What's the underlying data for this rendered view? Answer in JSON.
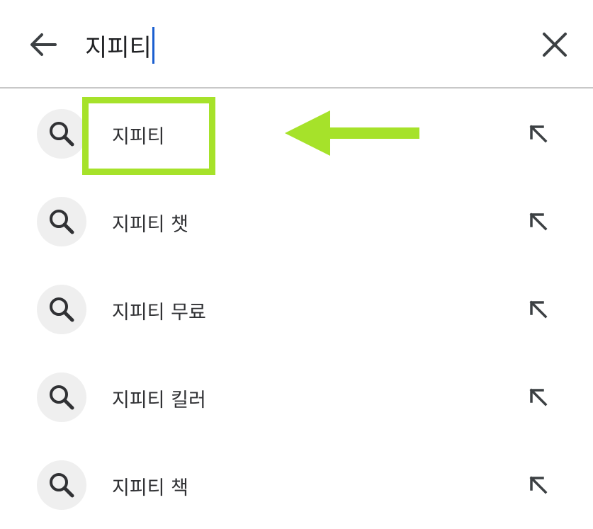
{
  "search_bar": {
    "query": "지피티",
    "back_icon": "arrow-left-icon",
    "clear_icon": "close-icon"
  },
  "suggestions": [
    {
      "label": "지피티",
      "icon": "search-icon",
      "action_icon": "arrow-up-left-icon"
    },
    {
      "label": "지피티 챗",
      "icon": "search-icon",
      "action_icon": "arrow-up-left-icon"
    },
    {
      "label": "지피티 무료",
      "icon": "search-icon",
      "action_icon": "arrow-up-left-icon"
    },
    {
      "label": "지피티 킬러",
      "icon": "search-icon",
      "action_icon": "arrow-up-left-icon"
    },
    {
      "label": "지피티 책",
      "icon": "search-icon",
      "action_icon": "arrow-up-left-icon"
    }
  ],
  "annotation": {
    "color": "#a6e22a",
    "arrow_icon": "arrow-left-annotation-icon"
  }
}
